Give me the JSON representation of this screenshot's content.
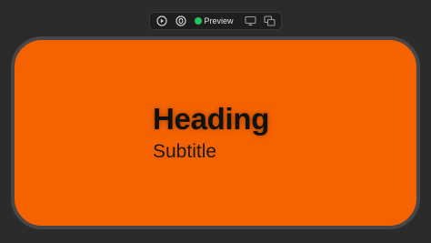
{
  "toolbar": {
    "icons": {
      "play": "play-circle-icon",
      "record": "record-circle-icon",
      "desktop": "desktop-icon",
      "duplicate": "duplicate-window-icon"
    },
    "preview_label": "Preview",
    "status_color": "#22c55e"
  },
  "preview": {
    "background_color": "#f56300",
    "heading": "Heading",
    "subtitle": "Subtitle"
  }
}
